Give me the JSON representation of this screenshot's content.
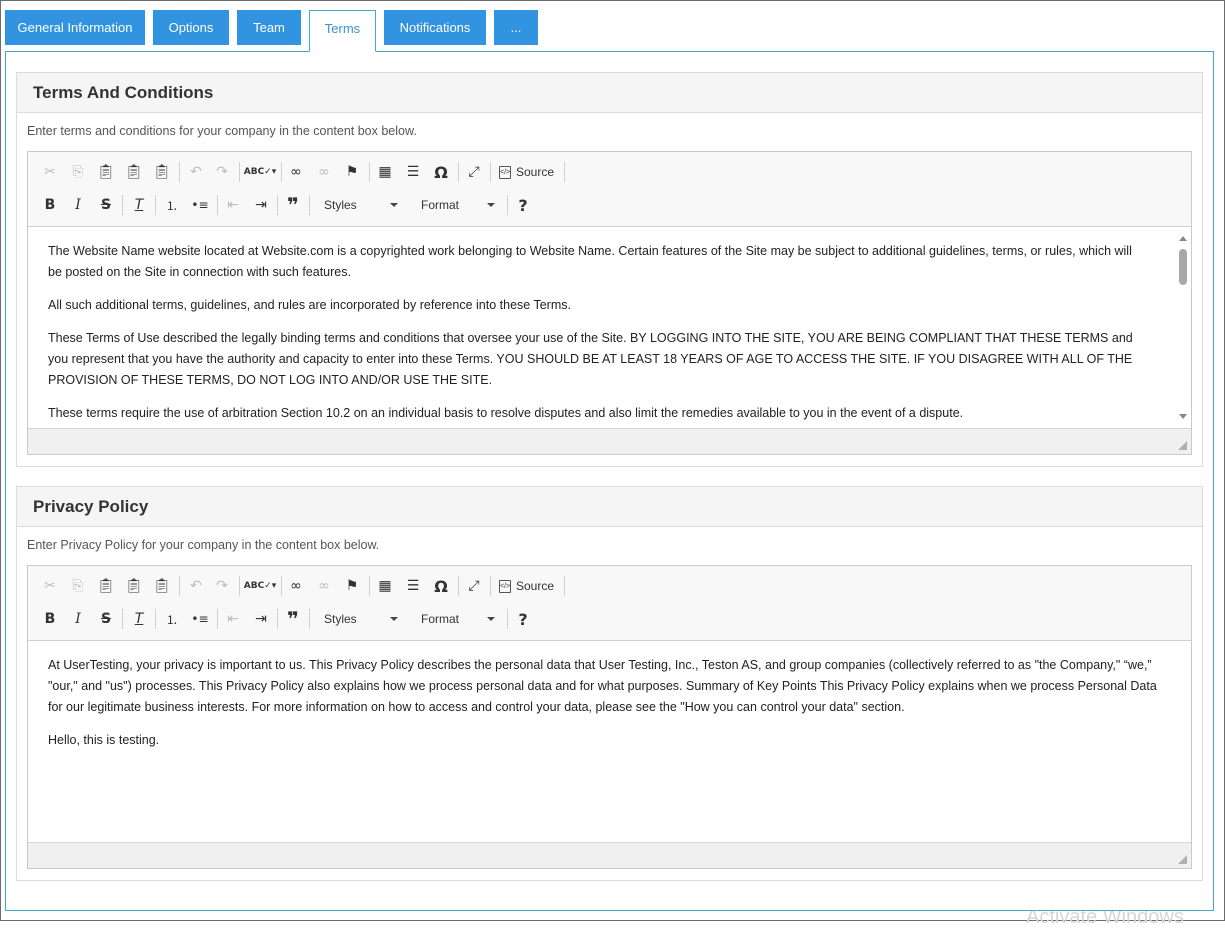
{
  "tabs": [
    {
      "label": "General Information",
      "active": false
    },
    {
      "label": "Options",
      "active": false
    },
    {
      "label": "Team",
      "active": false
    },
    {
      "label": "Terms",
      "active": true
    },
    {
      "label": "Notifications",
      "active": false
    },
    {
      "label": "...",
      "active": false
    }
  ],
  "colors": {
    "tab_bg": "#3293e0",
    "tab_active_text": "#3a8fd6",
    "panel_border": "#48a8c4"
  },
  "toolbar": {
    "row1_icons": [
      "cut-icon",
      "copy-icon",
      "paste-icon",
      "paste-text-icon",
      "paste-from-word-icon",
      "undo-icon",
      "redo-icon",
      "spellcheck-icon",
      "link-icon",
      "unlink-icon",
      "anchor-icon",
      "table-icon",
      "horizontal-rule-icon",
      "special-char-icon",
      "maximize-icon"
    ],
    "row2_icons": [
      "bold-icon",
      "italic-icon",
      "strikethrough-icon",
      "remove-format-icon",
      "numbered-list-icon",
      "bulleted-list-icon",
      "outdent-icon",
      "indent-icon",
      "blockquote-icon",
      "help-icon"
    ],
    "source_label": "Source",
    "styles_label": "Styles",
    "format_label": "Format",
    "bold_glyph": "B",
    "italic_glyph": "I",
    "strike_glyph": "S",
    "special_char_glyph": "Ω",
    "help_glyph": "?",
    "blockquote_glyph": "❞"
  },
  "terms": {
    "title": "Terms And Conditions",
    "description": "Enter terms and conditions for your company in the content box below.",
    "paragraphs": [
      "The Website Name website located at Website.com is a copyrighted work belonging to Website Name. Certain features of the Site may be subject to additional guidelines, terms, or rules, which will be posted on the Site in connection with such features.",
      "All such additional terms, guidelines, and rules are incorporated by reference into these Terms.",
      "These Terms of Use described the legally binding terms and conditions that oversee your use of the Site. BY LOGGING INTO THE SITE, YOU ARE BEING COMPLIANT THAT THESE TERMS and you represent that you have the authority and capacity to enter into these Terms. YOU SHOULD BE AT LEAST 18 YEARS OF AGE TO ACCESS THE SITE. IF YOU DISAGREE WITH ALL OF THE PROVISION OF THESE TERMS, DO NOT LOG INTO AND/OR USE THE SITE.",
      "These terms require the use of arbitration Section 10.2 on an individual basis to resolve disputes and also limit the remedies available to you in the event of a dispute."
    ]
  },
  "privacy": {
    "title": "Privacy Policy",
    "description": "Enter Privacy Policy for your company in the content box below.",
    "paragraphs": [
      "At UserTesting, your privacy is important to us. This Privacy Policy describes the personal data that User Testing, Inc., Teston AS, and group companies (collectively referred to as \"the Company,\" “we,” \"our,\" and \"us\") processes. This Privacy Policy also explains how we process personal data and for what purposes. Summary of Key Points This Privacy Policy explains when we process Personal Data for our legitimate business interests. For more information on how to access and control your data, please see the \"How you can control your data\" section.",
      "Hello, this is testing."
    ]
  },
  "watermark": "Activate Windows"
}
